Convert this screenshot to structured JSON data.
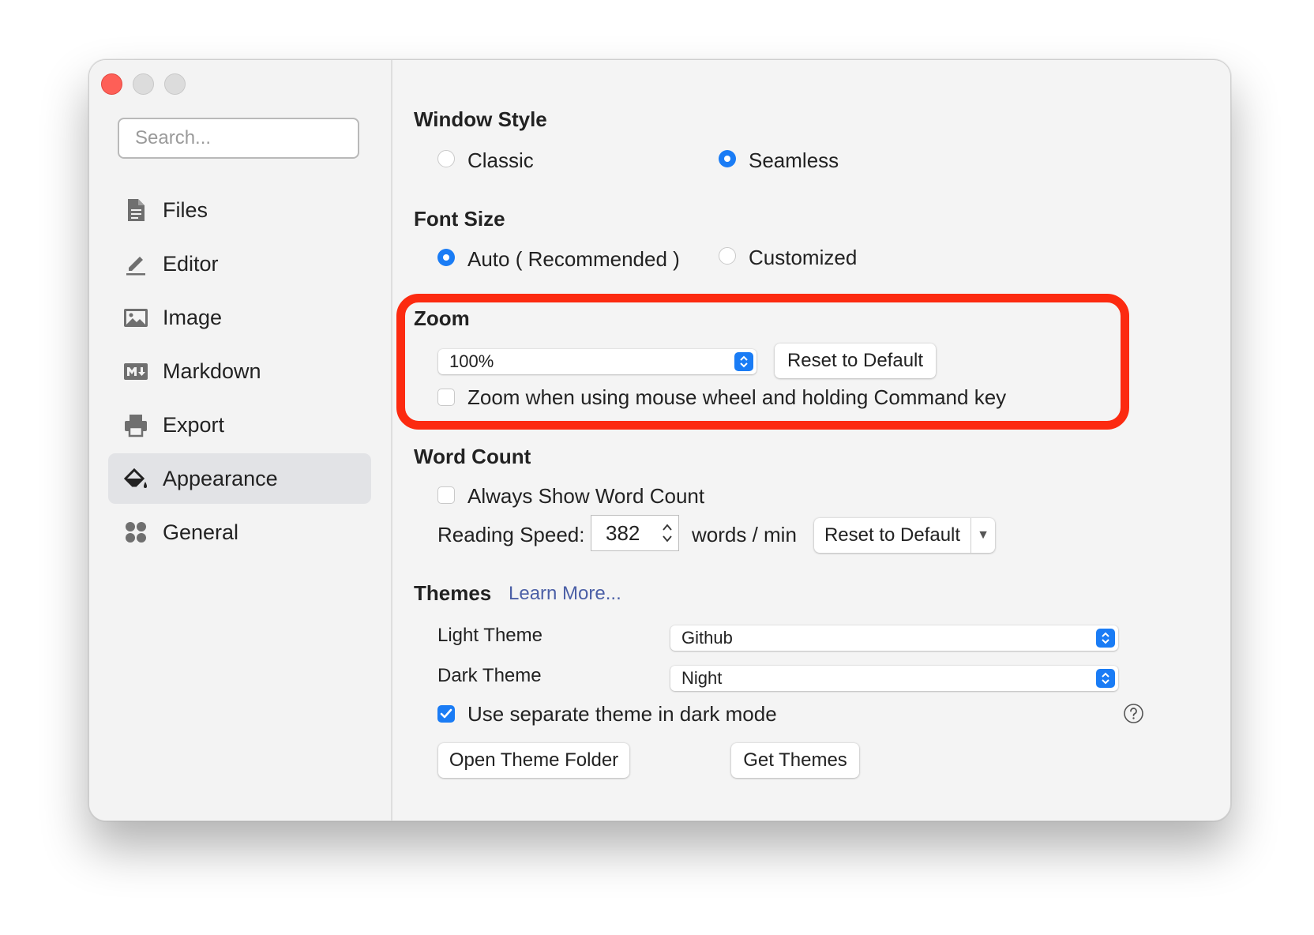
{
  "window": {
    "controls": [
      "close",
      "minimize",
      "maximize"
    ]
  },
  "sidebar": {
    "search_placeholder": "Search...",
    "items": [
      {
        "label": "Files",
        "icon": "file-icon"
      },
      {
        "label": "Editor",
        "icon": "pencil-icon"
      },
      {
        "label": "Image",
        "icon": "image-icon"
      },
      {
        "label": "Markdown",
        "icon": "markdown-icon"
      },
      {
        "label": "Export",
        "icon": "printer-icon"
      },
      {
        "label": "Appearance",
        "icon": "paint-bucket-icon",
        "selected": true
      },
      {
        "label": "General",
        "icon": "grid-icon"
      }
    ]
  },
  "window_style": {
    "title": "Window Style",
    "options": [
      "Classic",
      "Seamless"
    ],
    "selected": "Seamless"
  },
  "font_size": {
    "title": "Font Size",
    "options": [
      "Auto ( Recommended )",
      "Customized"
    ],
    "selected": "Auto ( Recommended )"
  },
  "zoom": {
    "title": "Zoom",
    "value": "100%",
    "reset_label": "Reset to Default",
    "mouse_wheel_label": "Zoom when using mouse wheel and holding Command key",
    "mouse_wheel_checked": false
  },
  "word_count": {
    "title": "Word Count",
    "always_show_label": "Always Show Word Count",
    "always_show_checked": false,
    "reading_speed_label": "Reading Speed:",
    "reading_speed_value": "382",
    "unit_label": "words / min",
    "reset_label": "Reset to Default"
  },
  "themes": {
    "title": "Themes",
    "learn_more": "Learn More...",
    "light_label": "Light Theme",
    "light_value": "Github",
    "dark_label": "Dark Theme",
    "dark_value": "Night",
    "separate_label": "Use separate theme in dark mode",
    "separate_checked": true,
    "open_folder_label": "Open Theme Folder",
    "get_themes_label": "Get Themes"
  },
  "colors": {
    "accent": "#1a7cf5",
    "highlight_border": "#fc2a10",
    "sidebar_selected": "#e2e3e6"
  }
}
